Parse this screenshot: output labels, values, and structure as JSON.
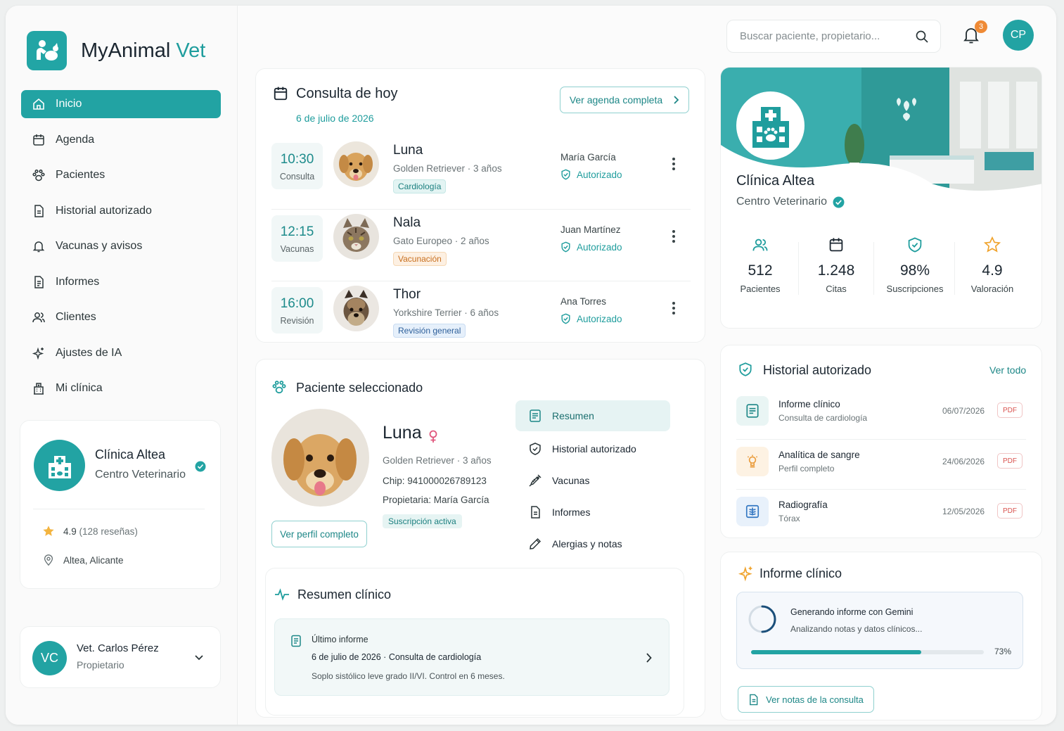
{
  "app": {
    "name_part1": "MyAnimal",
    "name_part2": "Vet"
  },
  "sidebar": {
    "items": [
      {
        "label": "Inicio",
        "icon": "home-icon",
        "active": true
      },
      {
        "label": "Agenda",
        "icon": "calendar-icon"
      },
      {
        "label": "Pacientes",
        "icon": "paw-icon"
      },
      {
        "label": "Historial autorizado",
        "icon": "document-icon"
      },
      {
        "label": "Vacunas y avisos",
        "icon": "bell-icon"
      },
      {
        "label": "Informes",
        "icon": "report-icon"
      },
      {
        "label": "Clientes",
        "icon": "users-icon"
      },
      {
        "label": "Ajustes de IA",
        "icon": "sparkles-icon"
      },
      {
        "label": "Mi clínica",
        "icon": "building-icon"
      }
    ],
    "clinic": {
      "name": "Clínica Altea",
      "type": "Centro Veterinario",
      "rating": "4.9",
      "reviews": "(128 reseñas)",
      "location": "Altea, Alicante"
    },
    "user": {
      "initials": "VC",
      "name": "Vet. Carlos Pérez",
      "role": "Propietario"
    }
  },
  "header": {
    "search_placeholder": "Buscar paciente, propietario...",
    "notifications": "3",
    "user_initials": "CP"
  },
  "today": {
    "title": "Consulta de hoy",
    "date": "6 de julio de 2026",
    "agenda_button": "Ver agenda completa",
    "appointments": [
      {
        "time": "10:30",
        "kind": "Consulta",
        "name": "Luna",
        "breed": "Golden Retriever · 3 años",
        "tag": "Cardiología",
        "owner": "María García",
        "status": "Autorizado"
      },
      {
        "time": "12:15",
        "kind": "Vacunas",
        "name": "Nala",
        "breed": "Gato Europeo · 2 años",
        "tag": "Vacunación",
        "owner": "Juan Martínez",
        "status": "Autorizado"
      },
      {
        "time": "16:00",
        "kind": "Revisión",
        "name": "Thor",
        "breed": "Yorkshire Terrier · 6 años",
        "tag": "Revisión general",
        "owner": "Ana Torres",
        "status": "Autorizado"
      }
    ]
  },
  "patient": {
    "section_title": "Paciente seleccionado",
    "name": "Luna",
    "breed": "Golden Retriever · 3 años",
    "chip": "Chip: 941000026789123",
    "owner": "Propietaria: María García",
    "subscription": "Suscripción activa",
    "profile_button": "Ver perfil completo",
    "tabs": [
      {
        "label": "Resumen",
        "icon": "summary-icon",
        "active": true
      },
      {
        "label": "Historial autorizado",
        "icon": "shield-icon"
      },
      {
        "label": "Vacunas",
        "icon": "syringe-icon"
      },
      {
        "label": "Informes",
        "icon": "report-icon"
      },
      {
        "label": "Alergias y notas",
        "icon": "pencil-icon"
      }
    ]
  },
  "summary": {
    "title": "Resumen clínico",
    "label": "Último informe",
    "date": "6 de julio de 2026",
    "consult": "Consulta de cardiología",
    "note": "Soplo sistólico leve grado II/VI. Control en 6 meses."
  },
  "clinic": {
    "name": "Clínica Altea",
    "type": "Centro Veterinario",
    "stats": [
      {
        "value": "512",
        "label": "Pacientes",
        "icon": "users-icon"
      },
      {
        "value": "1.248",
        "label": "Citas",
        "icon": "calendar-icon"
      },
      {
        "value": "98%",
        "label": "Suscripciones",
        "icon": "shield-check-icon"
      },
      {
        "value": "4.9",
        "label": "Valoración",
        "icon": "star-icon"
      }
    ]
  },
  "history": {
    "title": "Historial autorizado",
    "view_all": "Ver todo",
    "items": [
      {
        "title": "Informe clínico",
        "sub": "Consulta de cardiología",
        "date": "06/07/2026",
        "badge": "PDF",
        "icon": "document-icon"
      },
      {
        "title": "Analítica de sangre",
        "sub": "Perfil completo",
        "date": "24/06/2026",
        "badge": "PDF",
        "icon": "microscope-icon"
      },
      {
        "title": "Radiografía",
        "sub": "Tórax",
        "date": "12/05/2026",
        "badge": "PDF",
        "icon": "xray-icon"
      }
    ]
  },
  "report": {
    "title": "Informe clínico",
    "generating": "Generando informe con Gemini",
    "analyzing": "Analizando notas y datos clínicos...",
    "progress": 0.73,
    "progress_text": "73%",
    "notes_button": "Ver notas de la consulta"
  },
  "colors": {
    "accent": "#22a3a3",
    "accent_dark": "#1d8b8b",
    "orange": "#ef8a35",
    "pdf_red": "#d9534f"
  }
}
